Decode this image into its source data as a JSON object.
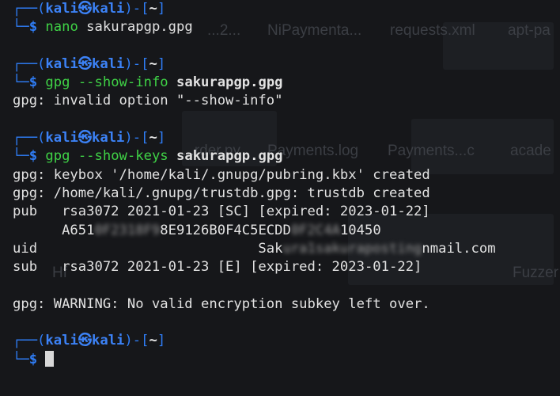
{
  "background_ghosts": [
    "...2...",
    "NiPaymenta...",
    "requests.xml",
    "apt-pa",
    "...rder.py",
    "Payments.log",
    "Payments...c",
    "acade",
    "Hf",
    "Fuzzer"
  ],
  "prompt": {
    "user": "kali",
    "at_symbol": "㉿",
    "host": "kali",
    "path": "~",
    "dollar": "$"
  },
  "commands": [
    {
      "cmd": "nano",
      "args": " sakurapgp.gpg"
    },
    {
      "cmd": "gpg",
      "opt": " --show-info",
      "file": " sakurapgp.gpg"
    },
    {
      "cmd": "gpg",
      "opt": " --show-keys",
      "file": " sakurapgp.gpg"
    }
  ],
  "output": {
    "invalid_option": "gpg: invalid option \"--show-info\"",
    "keybox_created": "gpg: keybox '/home/kali/.gnupg/pubring.kbx' created",
    "trustdb_created": "gpg: /home/kali/.gnupg/trustdb.gpg: trustdb created",
    "pub_line": "pub   rsa3072 2021-01-23 [SC] [expired: 2023-01-22]",
    "fingerprint_a": "      A651",
    "fingerprint_blur1": "0F2318F9",
    "fingerprint_b": "8E9126B0F4C5ECDD",
    "fingerprint_blur2": "0F2C4A",
    "fingerprint_c": "10450",
    "uid_label": "uid                           Sak",
    "uid_blur": "ura1sakuraposting",
    "uid_end": "nmail.com",
    "sub_line": "sub   rsa3072 2021-01-23 [E] [expired: 2023-01-22]",
    "warning": "gpg: WARNING: No valid encryption subkey left over."
  },
  "colors": {
    "prompt_frame": "#2f7df6",
    "command": "#3fd246",
    "user_host": "#3c82f6",
    "text": "#e2e2e2",
    "background": "#16171a"
  }
}
